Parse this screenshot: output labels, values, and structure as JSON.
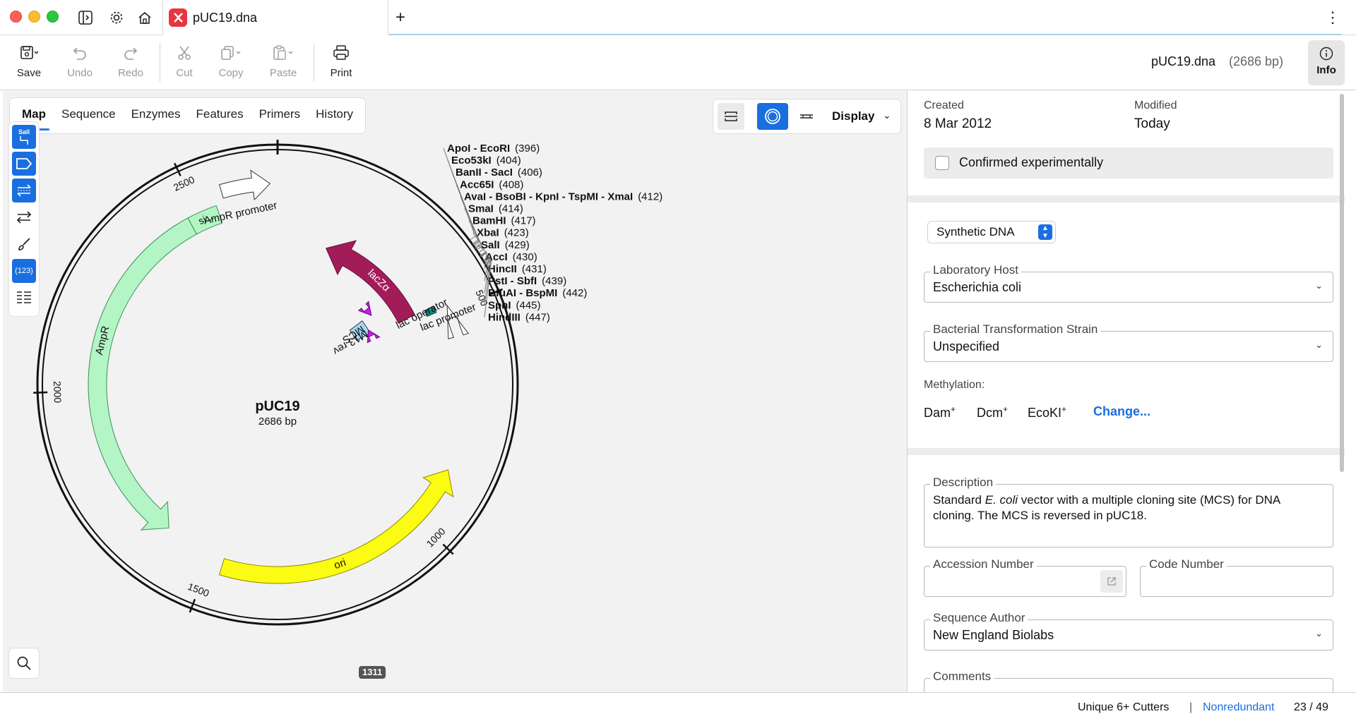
{
  "window": {
    "tab_title": "pUC19.dna",
    "add_tab": "+",
    "menu": "⋮"
  },
  "toolbar": {
    "save": "Save",
    "undo": "Undo",
    "redo": "Redo",
    "cut": "Cut",
    "copy": "Copy",
    "paste": "Paste",
    "print": "Print",
    "file_name": "pUC19.dna",
    "file_size": "(2686 bp)",
    "info": "Info"
  },
  "view_tabs": [
    "Map",
    "Sequence",
    "Enzymes",
    "Features",
    "Primers",
    "History"
  ],
  "display": {
    "label": "Display"
  },
  "side_tools": {
    "enzyme_label": "SalI",
    "numbers_label": "(123)"
  },
  "map": {
    "name": "pUC19",
    "length": "2686 bp",
    "cursor_position": "1311",
    "ticks": [
      "500",
      "1000",
      "1500",
      "2000",
      "2500"
    ],
    "features": [
      {
        "label": "lacZα",
        "color": "#a31c5a"
      },
      {
        "label": "AmpR",
        "color": "#b4f5c6"
      },
      {
        "label": "ori",
        "color": "#fbfb13"
      },
      {
        "label": "AmpR promoter",
        "color": "#ffffff"
      },
      {
        "label": "si...",
        "color": "#b4f5c6"
      },
      {
        "label": "lac promoter",
        "color": "#ffffff"
      },
      {
        "label": "lac operator",
        "color": "#138780"
      },
      {
        "label": "MCS",
        "color": "#a8d5f5"
      },
      {
        "label": "M13 rev",
        "color": "#c61ce6"
      }
    ],
    "enzymes": [
      {
        "name": "ApoI - EcoRI",
        "pos": "(396)"
      },
      {
        "name": "Eco53kI",
        "pos": "(404)"
      },
      {
        "name": "BanII - SacI",
        "pos": "(406)"
      },
      {
        "name": "Acc65I",
        "pos": "(408)"
      },
      {
        "name": "AvaI - BsoBI - KpnI - TspMI - XmaI",
        "pos": "(412)"
      },
      {
        "name": "SmaI",
        "pos": "(414)"
      },
      {
        "name": "BamHI",
        "pos": "(417)"
      },
      {
        "name": "XbaI",
        "pos": "(423)"
      },
      {
        "name": "SalI",
        "pos": "(429)"
      },
      {
        "name": "AccI",
        "pos": "(430)"
      },
      {
        "name": "HincII",
        "pos": "(431)"
      },
      {
        "name": "PstI - SbfI",
        "pos": "(439)"
      },
      {
        "name": "BfuAI - BspMI",
        "pos": "(442)"
      },
      {
        "name": "SphI",
        "pos": "(445)"
      },
      {
        "name": "HindIII",
        "pos": "(447)"
      }
    ]
  },
  "info": {
    "created_label": "Created",
    "created_value": "8 Mar 2012",
    "modified_label": "Modified",
    "modified_value": "Today",
    "confirmed": "Confirmed experimentally",
    "molecule_type": "Synthetic DNA",
    "host_label": "Laboratory Host",
    "host_value": "Escherichia coli",
    "strain_label": "Bacterial Transformation Strain",
    "strain_value": "Unspecified",
    "methylation_label": "Methylation:",
    "methylation": [
      {
        "name": "Dam",
        "sign": "+"
      },
      {
        "name": "Dcm",
        "sign": "+"
      },
      {
        "name": "EcoKI",
        "sign": "+"
      }
    ],
    "change": "Change...",
    "description_label": "Description",
    "description_pre": "Standard ",
    "description_em": "E. coli",
    "description_post": " vector with a multiple cloning site (MCS) for DNA cloning. The MCS is reversed in pUC18.",
    "accession_label": "Accession Number",
    "code_label": "Code Number",
    "author_label": "Sequence Author",
    "author_value": "New England Biolabs",
    "comments_label": "Comments"
  },
  "status": {
    "cutters": "Unique 6+ Cutters",
    "separator": "|",
    "nonredundant": "Nonredundant",
    "count": "23 / 49"
  }
}
